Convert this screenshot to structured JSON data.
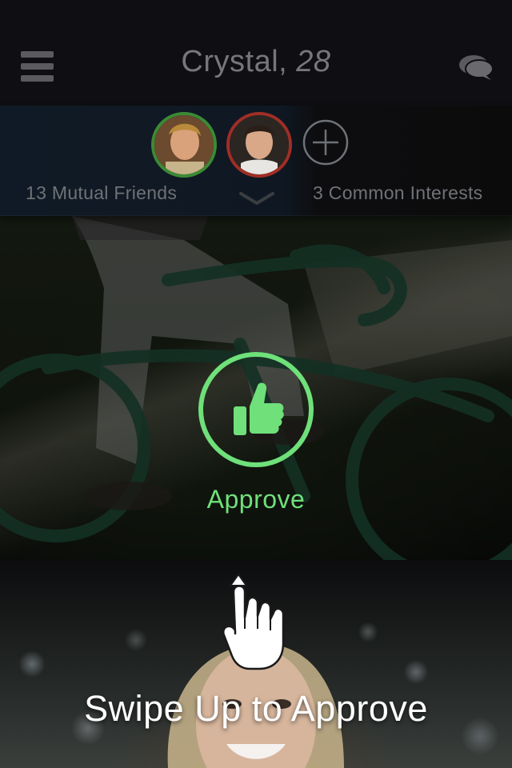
{
  "header": {
    "name": "Crystal,",
    "age": "28"
  },
  "social": {
    "mutual_friends_label": "13 Mutual Friends",
    "common_interests_label": "3 Common Interests"
  },
  "approve": {
    "label": "Approve"
  },
  "swipe_hint": {
    "label": "Swipe Up to Approve"
  },
  "icons": {
    "menu": "hamburger-menu-icon",
    "chat": "chat-bubbles-icon",
    "add": "plus-circle-icon",
    "expand": "chevron-down-icon",
    "approve": "thumbs-up-icon",
    "swipe": "swipe-up-hand-icon"
  },
  "colors": {
    "accent_green": "#6fe07a",
    "friend_ring_green": "#3c8a35",
    "friend_ring_red": "#a02e26",
    "header_bg": "#0e0e13",
    "header_text": "#76767b"
  }
}
